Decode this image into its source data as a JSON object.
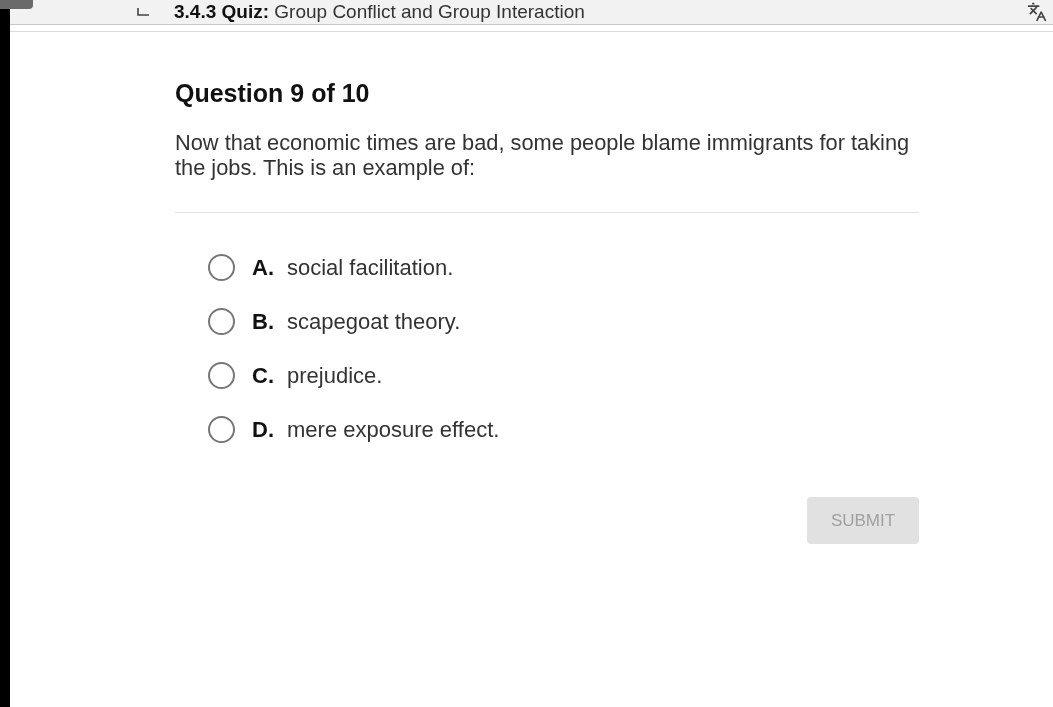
{
  "header": {
    "title": "**3.4.3 Quiz:** Group Conflict and Group Interaction"
  },
  "question": {
    "heading": "Question 9 of 10",
    "prompt": "Now that economic times are bad, some people blame immigrants for taking the jobs. This is an example of:"
  },
  "options": [
    {
      "letter": "A.",
      "text": "social facilitation.",
      "selected": false
    },
    {
      "letter": "B.",
      "text": "scapegoat theory.",
      "selected": false
    },
    {
      "letter": "C.",
      "text": "prejudice.",
      "selected": false
    },
    {
      "letter": "D.",
      "text": "mere exposure effect.",
      "selected": false
    }
  ],
  "submit": {
    "label": "SUBMIT",
    "disabled": true
  }
}
